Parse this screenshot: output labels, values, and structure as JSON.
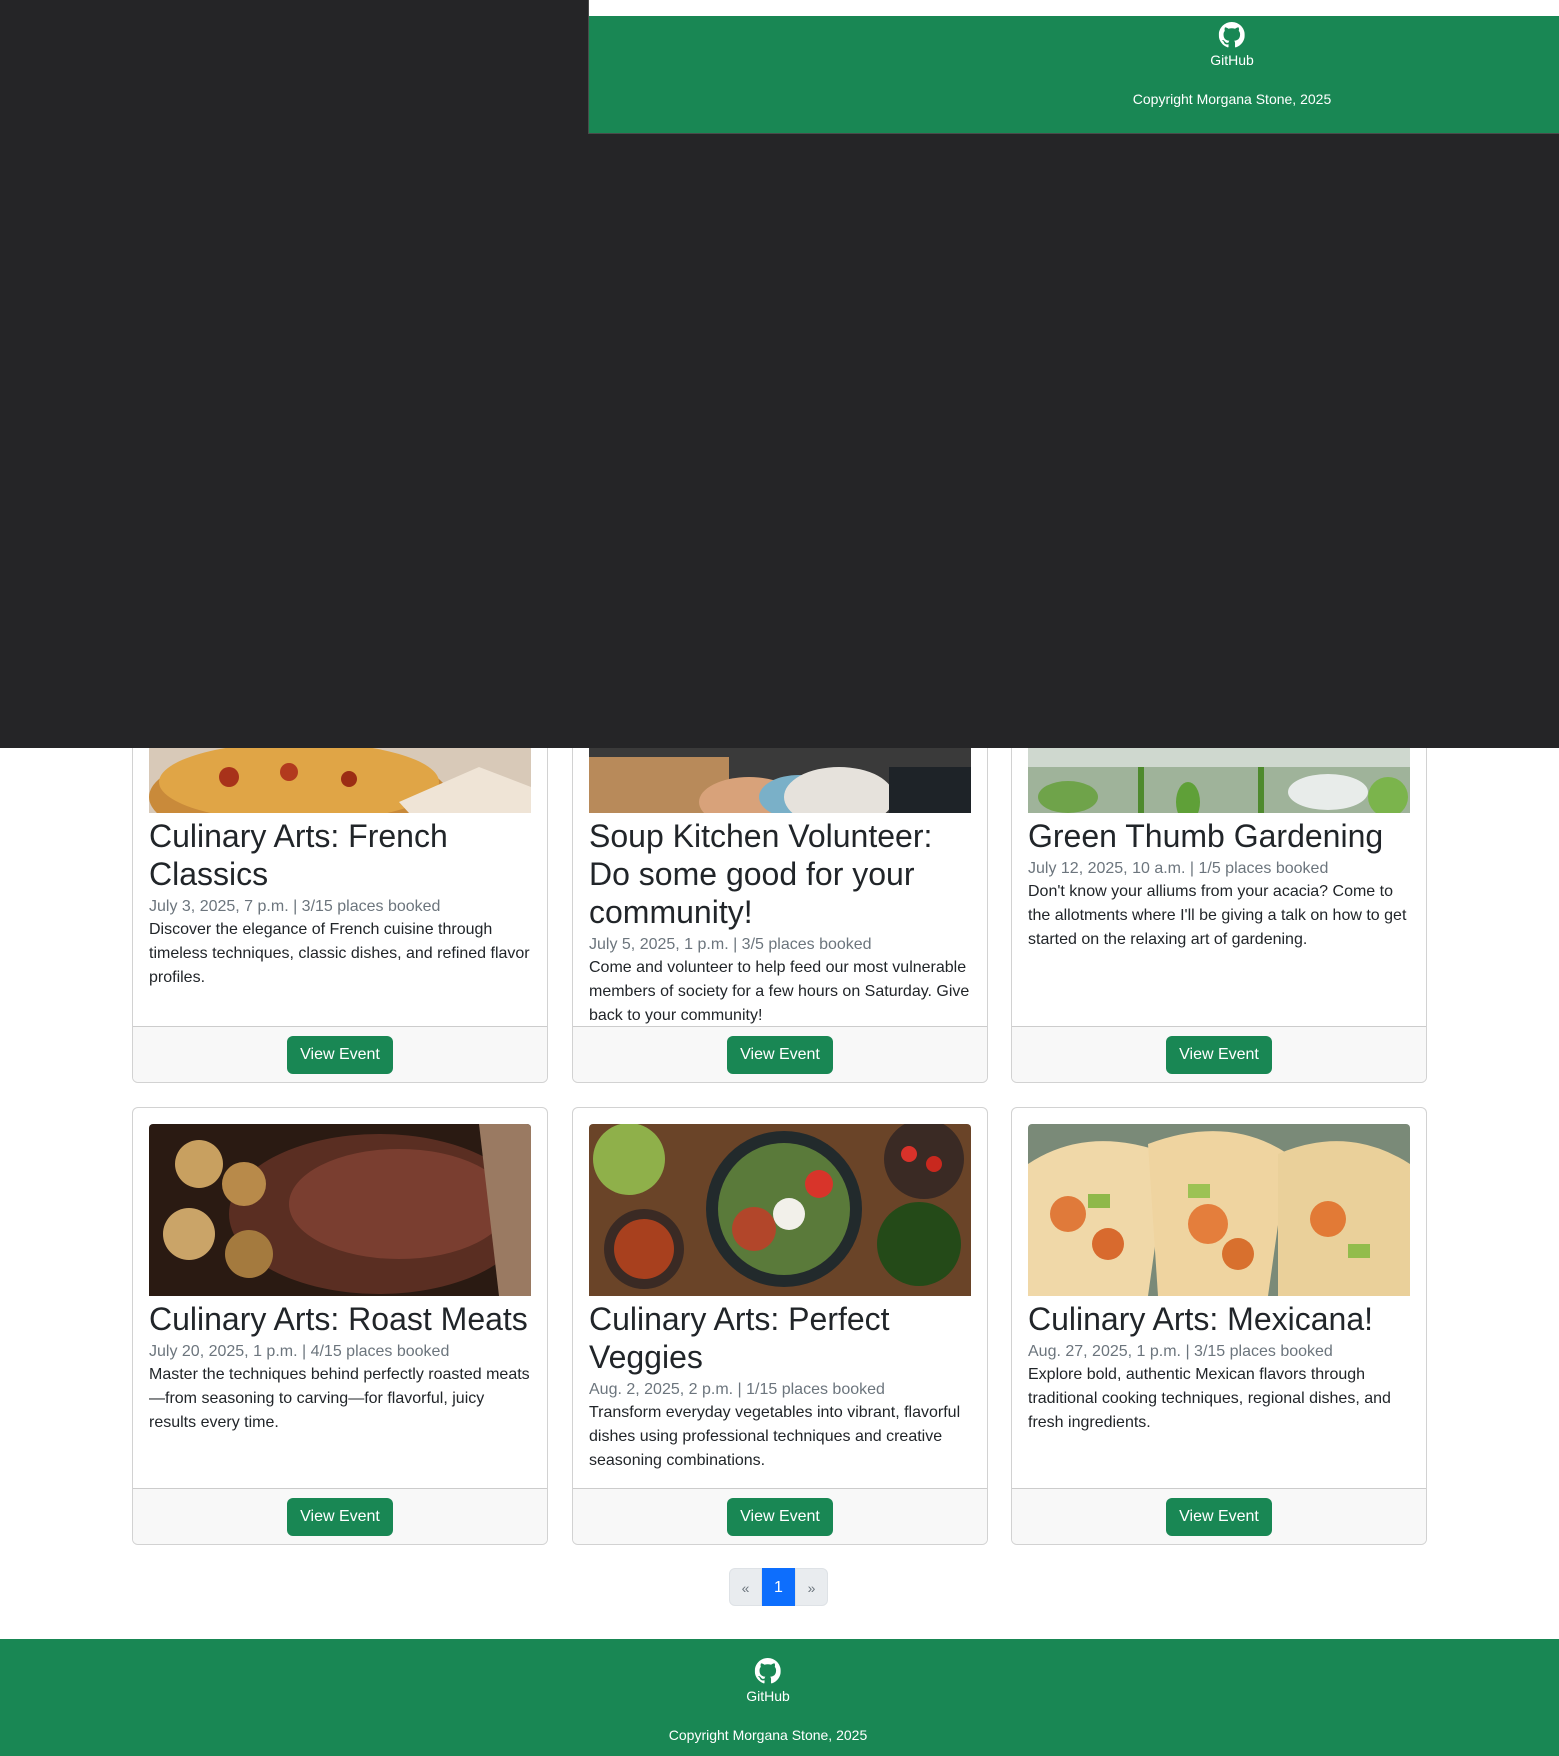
{
  "footer": {
    "link_label": "GitHub",
    "copyright": "Copyright Morgana Stone, 2025"
  },
  "events": [
    {
      "title": "Culinary Arts: French Classics",
      "meta": "July 3, 2025, 7 p.m. | 3/15 places booked",
      "description": "Discover the elegance of French cuisine through timeless techniques, classic dishes, and refined flavor profiles.",
      "button": "View Event",
      "image": "quiche-photo"
    },
    {
      "title": "Soup Kitchen Volunteer: Do some good for your community!",
      "meta": "July 5, 2025, 1 p.m. | 3/5 places booked",
      "description": "Come and volunteer to help feed our most vulnerable members of society for a few hours on Saturday. Give back to your community!",
      "button": "View Event",
      "image": "volunteers-photo"
    },
    {
      "title": "Green Thumb Gardening",
      "meta": "July 12, 2025, 10 a.m. | 1/5 places booked",
      "description": "Don't know your alliums from your acacia? Come to the allotments where I'll be giving a talk on how to get started on the relaxing art of gardening.",
      "button": "View Event",
      "image": "seedlings-photo"
    },
    {
      "title": "Culinary Arts: Roast Meats",
      "meta": "July 20, 2025, 1 p.m. | 4/15 places booked",
      "description": "Master the techniques behind perfectly roasted meats—from seasoning to carving—for flavorful, juicy results every time.",
      "button": "View Event",
      "image": "roast-meat-photo"
    },
    {
      "title": "Culinary Arts: Perfect Veggies",
      "meta": "Aug. 2, 2025, 2 p.m. | 1/15 places booked",
      "description": "Transform everyday vegetables into vibrant, flavorful dishes using professional techniques and creative seasoning combinations.",
      "button": "View Event",
      "image": "veggie-bowl-photo"
    },
    {
      "title": "Culinary Arts: Mexicana!",
      "meta": "Aug. 27, 2025, 1 p.m. | 3/15 places booked",
      "description": "Explore bold, authentic Mexican flavors through traditional cooking techniques, regional dishes, and fresh ingredients.",
      "button": "View Event",
      "image": "tacos-photo"
    }
  ],
  "pagination": {
    "prev": "«",
    "current": "1",
    "next": "»"
  },
  "colors": {
    "primary_green": "#198754",
    "overlay_dark": "#252527",
    "active_page": "#0d6efd"
  }
}
